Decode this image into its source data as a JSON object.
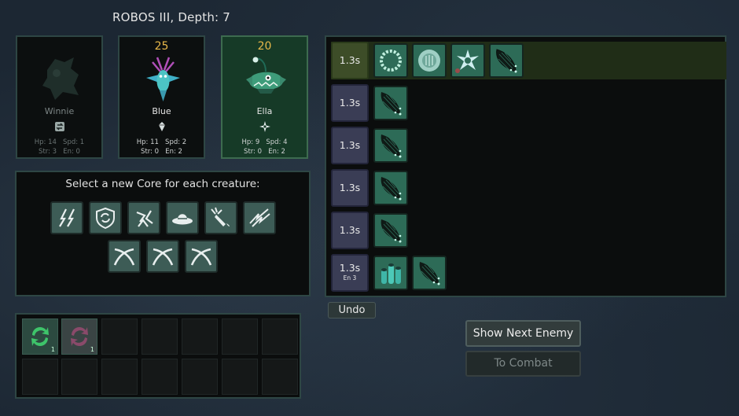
{
  "header": {
    "title": "ROBOS III, Depth: 7"
  },
  "creatures": [
    {
      "name": "Winnie",
      "level": "",
      "hp": "Hp: 14",
      "spd": "Spd: 1",
      "str": "Str: 3",
      "en": "En: 0",
      "state": "defeated",
      "core_icon": "swap-core-icon"
    },
    {
      "name": "Blue",
      "level": "25",
      "hp": "Hp: 11",
      "spd": "Spd: 2",
      "str": "Str: 0",
      "en": "En: 2",
      "state": "normal",
      "core_icon": "crystal-core-icon"
    },
    {
      "name": "Ella",
      "level": "20",
      "hp": "Hp: 9",
      "spd": "Spd: 4",
      "str": "Str: 0",
      "en": "En: 2",
      "state": "selected",
      "core_icon": "shuriken-core-icon"
    }
  ],
  "core_select": {
    "heading": "Select a new Core for each creature:",
    "cores": [
      "double-lightning-core-icon",
      "shield-refresh-core-icon",
      "spinning-arrows-core-icon",
      "hat-core-icon",
      "carrot-core-icon",
      "lightning-claw-core-icon",
      "crossed-swords-core-icon",
      "crossed-swords-core-icon",
      "crossed-swords-core-icon"
    ]
  },
  "inventory": {
    "slots": [
      {
        "icon": "green-refresh-icon",
        "count": "1"
      },
      {
        "icon": "red-refresh-icon",
        "count": "1"
      },
      {
        "icon": "",
        "count": ""
      },
      {
        "icon": "",
        "count": ""
      },
      {
        "icon": "",
        "count": ""
      },
      {
        "icon": "",
        "count": ""
      },
      {
        "icon": "",
        "count": ""
      },
      {
        "icon": "",
        "count": ""
      },
      {
        "icon": "",
        "count": ""
      },
      {
        "icon": "",
        "count": ""
      },
      {
        "icon": "",
        "count": ""
      },
      {
        "icon": "",
        "count": ""
      },
      {
        "icon": "",
        "count": ""
      },
      {
        "icon": "",
        "count": ""
      }
    ]
  },
  "turn_queue": [
    {
      "time": "1.3s",
      "energy": "",
      "active": true,
      "actions": [
        "ring-wreath-icon",
        "fuzzy-orb-icon",
        "vortex-icon",
        "net-icon"
      ]
    },
    {
      "time": "1.3s",
      "energy": "",
      "active": false,
      "actions": [
        "net-icon"
      ]
    },
    {
      "time": "1.3s",
      "energy": "",
      "active": false,
      "actions": [
        "net-icon"
      ]
    },
    {
      "time": "1.3s",
      "energy": "",
      "active": false,
      "actions": [
        "net-icon"
      ]
    },
    {
      "time": "1.3s",
      "energy": "",
      "active": false,
      "actions": [
        "net-icon"
      ]
    },
    {
      "time": "1.3s",
      "energy": "En 3",
      "active": false,
      "actions": [
        "coral-icon",
        "net-icon"
      ]
    }
  ],
  "buttons": {
    "undo": "Undo",
    "show_next_enemy": "Show Next Enemy",
    "to_combat": "To Combat"
  },
  "colors": {
    "level": "#e8b84a",
    "selected_card": "#163a27",
    "panel_border": "#2e4644",
    "action_tile": "#2d6b57"
  }
}
